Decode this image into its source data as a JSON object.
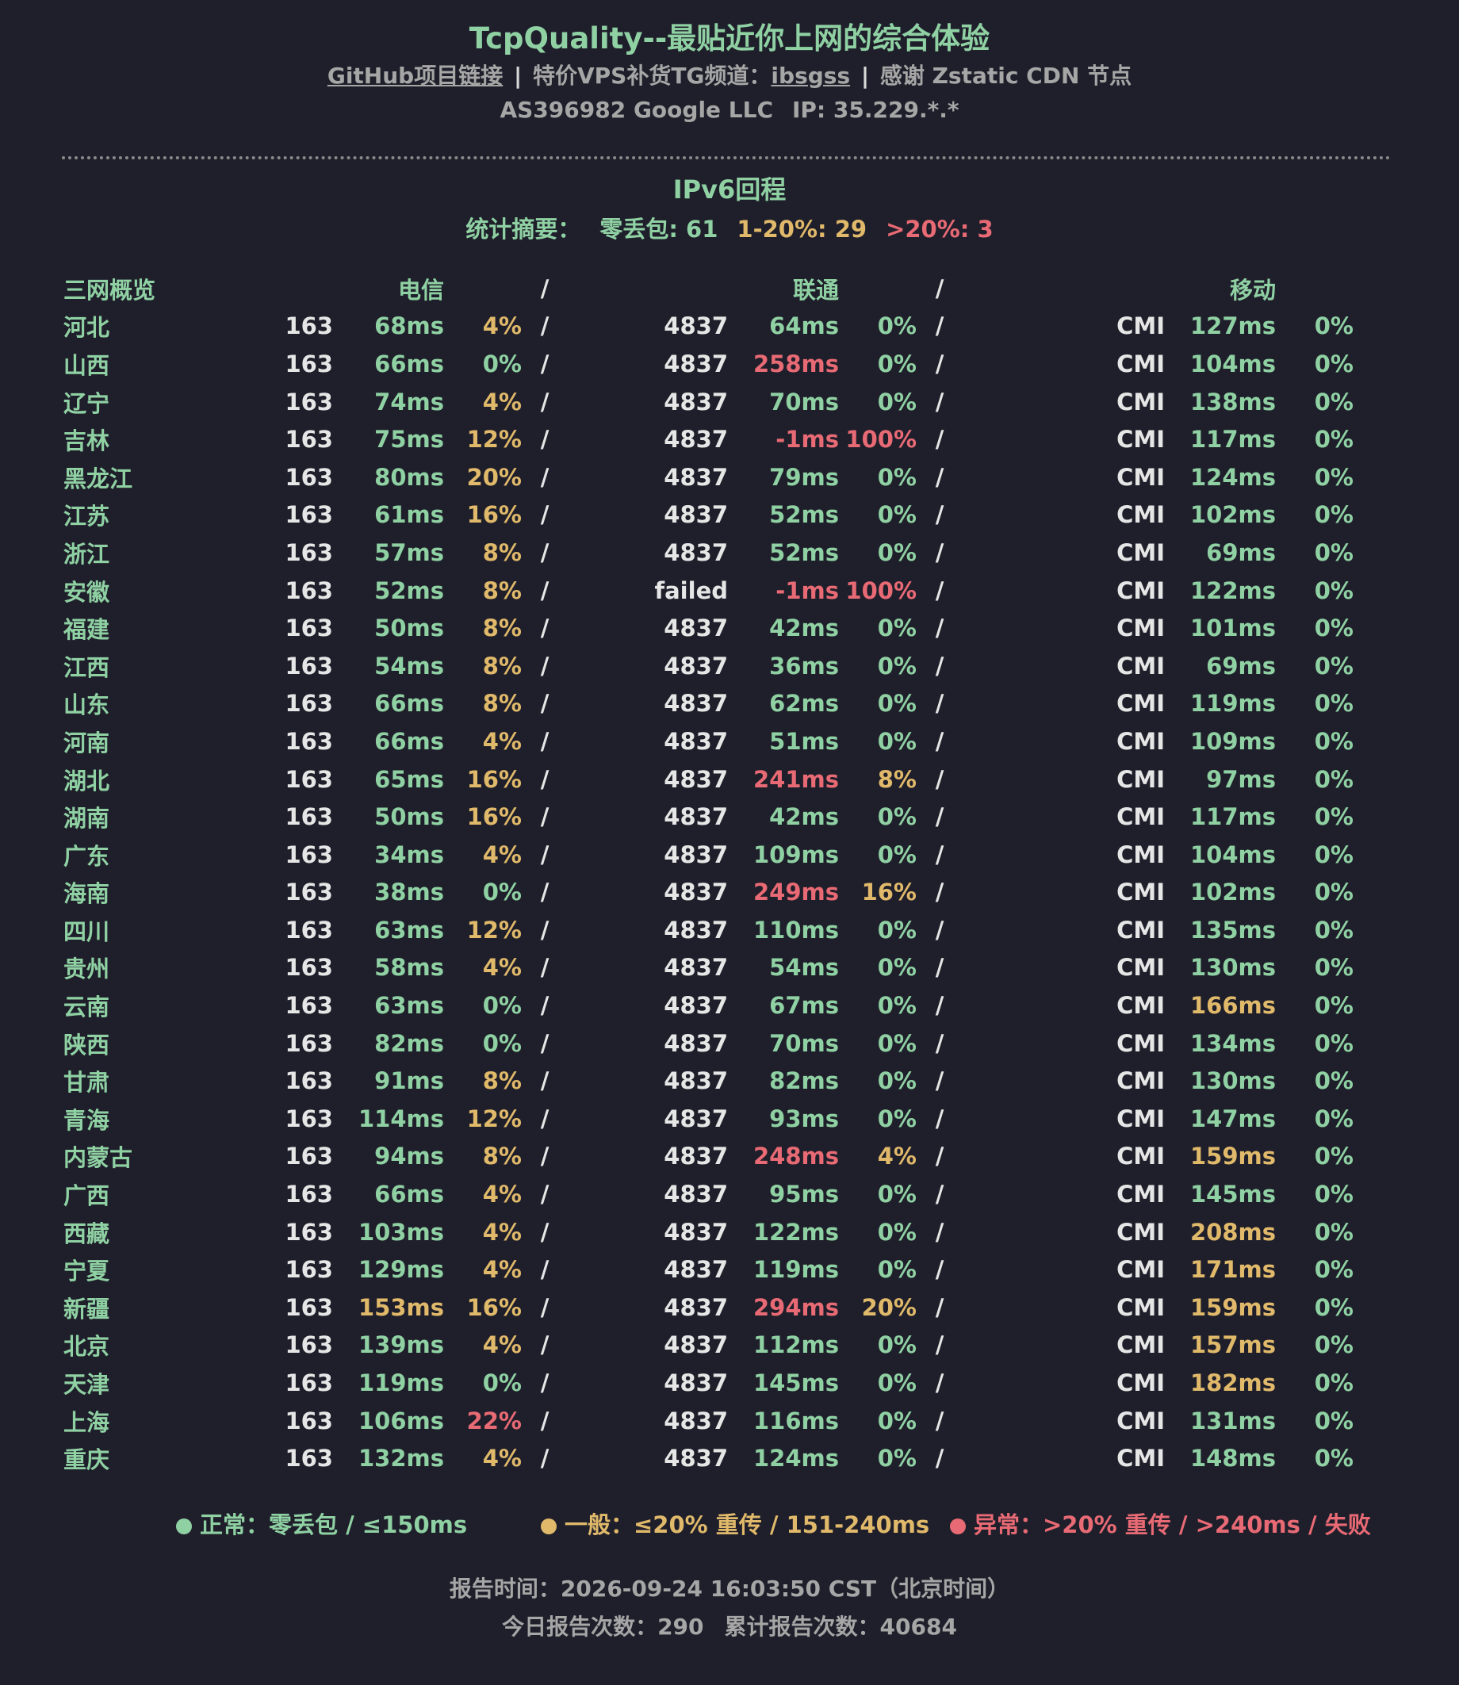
{
  "header": {
    "title": "TcpQuality--最贴近你上网的综合体验",
    "links": {
      "github": "GitHub项目链接",
      "sep1": "|",
      "tg_prefix": "特价VPS补货TG频道：",
      "tg_handle": "ibsgss",
      "sep2": "|",
      "thanks": "感谢 Zstatic CDN 节点"
    },
    "as_info": "AS396982 Google LLC",
    "ip": "IP: 35.229.*.*"
  },
  "section": {
    "title": "IPv6回程",
    "summary_label": "统计摘要：",
    "summary_zero": "零丢包: 61",
    "summary_mid": "1-20%: 29",
    "summary_high": ">20%: 3"
  },
  "table": {
    "headers": {
      "overview": "三网概览",
      "telecom": "电信",
      "unicom": "联通",
      "mobile": "移动",
      "sep": "/"
    },
    "rows": [
      {
        "p": "河北",
        "a1": "163",
        "m1": "68ms",
        "l1": "4%",
        "a2": "4837",
        "m2": "64ms",
        "l2": "0%",
        "a3": "CMI",
        "m3": "127ms",
        "l3": "0%",
        "s": "/"
      },
      {
        "p": "山西",
        "a1": "163",
        "m1": "66ms",
        "l1": "0%",
        "a2": "4837",
        "m2": "258ms",
        "l2": "0%",
        "a3": "CMI",
        "m3": "104ms",
        "l3": "0%",
        "s": "/"
      },
      {
        "p": "辽宁",
        "a1": "163",
        "m1": "74ms",
        "l1": "4%",
        "a2": "4837",
        "m2": "70ms",
        "l2": "0%",
        "a3": "CMI",
        "m3": "138ms",
        "l3": "0%",
        "s": "/"
      },
      {
        "p": "吉林",
        "a1": "163",
        "m1": "75ms",
        "l1": "12%",
        "a2": "4837",
        "m2": "-1ms",
        "l2": "100%",
        "a3": "CMI",
        "m3": "117ms",
        "l3": "0%",
        "s": "/"
      },
      {
        "p": "黑龙江",
        "a1": "163",
        "m1": "80ms",
        "l1": "20%",
        "a2": "4837",
        "m2": "79ms",
        "l2": "0%",
        "a3": "CMI",
        "m3": "124ms",
        "l3": "0%",
        "s": "/"
      },
      {
        "p": "江苏",
        "a1": "163",
        "m1": "61ms",
        "l1": "16%",
        "a2": "4837",
        "m2": "52ms",
        "l2": "0%",
        "a3": "CMI",
        "m3": "102ms",
        "l3": "0%",
        "s": "/"
      },
      {
        "p": "浙江",
        "a1": "163",
        "m1": "57ms",
        "l1": "8%",
        "a2": "4837",
        "m2": "52ms",
        "l2": "0%",
        "a3": "CMI",
        "m3": "69ms",
        "l3": "0%",
        "s": "/"
      },
      {
        "p": "安徽",
        "a1": "163",
        "m1": "52ms",
        "l1": "8%",
        "a2": "failed",
        "m2": "-1ms",
        "l2": "100%",
        "a3": "CMI",
        "m3": "122ms",
        "l3": "0%",
        "s": "/"
      },
      {
        "p": "福建",
        "a1": "163",
        "m1": "50ms",
        "l1": "8%",
        "a2": "4837",
        "m2": "42ms",
        "l2": "0%",
        "a3": "CMI",
        "m3": "101ms",
        "l3": "0%",
        "s": "/"
      },
      {
        "p": "江西",
        "a1": "163",
        "m1": "54ms",
        "l1": "8%",
        "a2": "4837",
        "m2": "36ms",
        "l2": "0%",
        "a3": "CMI",
        "m3": "69ms",
        "l3": "0%",
        "s": "/"
      },
      {
        "p": "山东",
        "a1": "163",
        "m1": "66ms",
        "l1": "8%",
        "a2": "4837",
        "m2": "62ms",
        "l2": "0%",
        "a3": "CMI",
        "m3": "119ms",
        "l3": "0%",
        "s": "/"
      },
      {
        "p": "河南",
        "a1": "163",
        "m1": "66ms",
        "l1": "4%",
        "a2": "4837",
        "m2": "51ms",
        "l2": "0%",
        "a3": "CMI",
        "m3": "109ms",
        "l3": "0%",
        "s": "/"
      },
      {
        "p": "湖北",
        "a1": "163",
        "m1": "65ms",
        "l1": "16%",
        "a2": "4837",
        "m2": "241ms",
        "l2": "8%",
        "a3": "CMI",
        "m3": "97ms",
        "l3": "0%",
        "s": "/"
      },
      {
        "p": "湖南",
        "a1": "163",
        "m1": "50ms",
        "l1": "16%",
        "a2": "4837",
        "m2": "42ms",
        "l2": "0%",
        "a3": "CMI",
        "m3": "117ms",
        "l3": "0%",
        "s": "/"
      },
      {
        "p": "广东",
        "a1": "163",
        "m1": "34ms",
        "l1": "4%",
        "a2": "4837",
        "m2": "109ms",
        "l2": "0%",
        "a3": "CMI",
        "m3": "104ms",
        "l3": "0%",
        "s": "/"
      },
      {
        "p": "海南",
        "a1": "163",
        "m1": "38ms",
        "l1": "0%",
        "a2": "4837",
        "m2": "249ms",
        "l2": "16%",
        "a3": "CMI",
        "m3": "102ms",
        "l3": "0%",
        "s": "/"
      },
      {
        "p": "四川",
        "a1": "163",
        "m1": "63ms",
        "l1": "12%",
        "a2": "4837",
        "m2": "110ms",
        "l2": "0%",
        "a3": "CMI",
        "m3": "135ms",
        "l3": "0%",
        "s": "/"
      },
      {
        "p": "贵州",
        "a1": "163",
        "m1": "58ms",
        "l1": "4%",
        "a2": "4837",
        "m2": "54ms",
        "l2": "0%",
        "a3": "CMI",
        "m3": "130ms",
        "l3": "0%",
        "s": "/"
      },
      {
        "p": "云南",
        "a1": "163",
        "m1": "63ms",
        "l1": "0%",
        "a2": "4837",
        "m2": "67ms",
        "l2": "0%",
        "a3": "CMI",
        "m3": "166ms",
        "l3": "0%",
        "s": "/"
      },
      {
        "p": "陕西",
        "a1": "163",
        "m1": "82ms",
        "l1": "0%",
        "a2": "4837",
        "m2": "70ms",
        "l2": "0%",
        "a3": "CMI",
        "m3": "134ms",
        "l3": "0%",
        "s": "/"
      },
      {
        "p": "甘肃",
        "a1": "163",
        "m1": "91ms",
        "l1": "8%",
        "a2": "4837",
        "m2": "82ms",
        "l2": "0%",
        "a3": "CMI",
        "m3": "130ms",
        "l3": "0%",
        "s": "/"
      },
      {
        "p": "青海",
        "a1": "163",
        "m1": "114ms",
        "l1": "12%",
        "a2": "4837",
        "m2": "93ms",
        "l2": "0%",
        "a3": "CMI",
        "m3": "147ms",
        "l3": "0%",
        "s": "/"
      },
      {
        "p": "内蒙古",
        "a1": "163",
        "m1": "94ms",
        "l1": "8%",
        "a2": "4837",
        "m2": "248ms",
        "l2": "4%",
        "a3": "CMI",
        "m3": "159ms",
        "l3": "0%",
        "s": "/"
      },
      {
        "p": "广西",
        "a1": "163",
        "m1": "66ms",
        "l1": "4%",
        "a2": "4837",
        "m2": "95ms",
        "l2": "0%",
        "a3": "CMI",
        "m3": "145ms",
        "l3": "0%",
        "s": "/"
      },
      {
        "p": "西藏",
        "a1": "163",
        "m1": "103ms",
        "l1": "4%",
        "a2": "4837",
        "m2": "122ms",
        "l2": "0%",
        "a3": "CMI",
        "m3": "208ms",
        "l3": "0%",
        "s": "/"
      },
      {
        "p": "宁夏",
        "a1": "163",
        "m1": "129ms",
        "l1": "4%",
        "a2": "4837",
        "m2": "119ms",
        "l2": "0%",
        "a3": "CMI",
        "m3": "171ms",
        "l3": "0%",
        "s": "/"
      },
      {
        "p": "新疆",
        "a1": "163",
        "m1": "153ms",
        "l1": "16%",
        "a2": "4837",
        "m2": "294ms",
        "l2": "20%",
        "a3": "CMI",
        "m3": "159ms",
        "l3": "0%",
        "s": "/"
      },
      {
        "p": "北京",
        "a1": "163",
        "m1": "139ms",
        "l1": "4%",
        "a2": "4837",
        "m2": "112ms",
        "l2": "0%",
        "a3": "CMI",
        "m3": "157ms",
        "l3": "0%",
        "s": "/"
      },
      {
        "p": "天津",
        "a1": "163",
        "m1": "119ms",
        "l1": "0%",
        "a2": "4837",
        "m2": "145ms",
        "l2": "0%",
        "a3": "CMI",
        "m3": "182ms",
        "l3": "0%",
        "s": "/"
      },
      {
        "p": "上海",
        "a1": "163",
        "m1": "106ms",
        "l1": "22%",
        "a2": "4837",
        "m2": "116ms",
        "l2": "0%",
        "a3": "CMI",
        "m3": "131ms",
        "l3": "0%",
        "s": "/"
      },
      {
        "p": "重庆",
        "a1": "163",
        "m1": "132ms",
        "l1": "4%",
        "a2": "4837",
        "m2": "124ms",
        "l2": "0%",
        "a3": "CMI",
        "m3": "148ms",
        "l3": "0%",
        "s": "/"
      }
    ]
  },
  "legend": {
    "normal": "正常：零丢包 / ≤150ms",
    "general": "一般：≤20% 重传 / 151-240ms",
    "abnormal": "异常：>20% 重传 / >240ms / 失败"
  },
  "colors": {
    "good": "#8fd1a3",
    "warn": "#e0b96a",
    "bad": "#e86a74",
    "background": "#1f1f2b"
  },
  "footer": {
    "report_time": "报告时间：2026-09-24 16:03:50 CST（北京时间）",
    "today_count": "今日报告次数：290",
    "total_count": "累计报告次数：40684"
  }
}
